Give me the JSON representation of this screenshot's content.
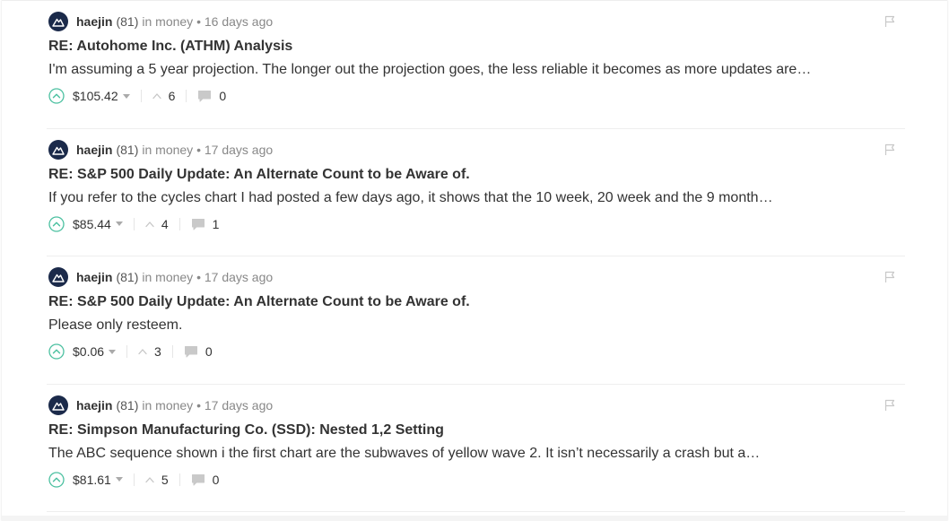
{
  "colors": {
    "avatar_bg": "#1b2a4a",
    "upvote_green": "#4bc0a0",
    "muted": "#888888"
  },
  "icons": {
    "upvote": "chevron-up-circle-icon",
    "votes": "chevron-up-icon",
    "comments": "comment-icon",
    "flag": "flag-icon",
    "payout_menu": "caret-down-icon"
  },
  "posts": [
    {
      "author": "haejin",
      "reputation": "(81)",
      "meta": "in money • 16 days ago",
      "title": "RE: Autohome Inc. (ATHM) Analysis",
      "body": "I'm assuming a 5 year projection. The longer out the projection goes, the less reliable it becomes as more updates are…",
      "payout": "$105.42",
      "votes": "6",
      "comments": "0"
    },
    {
      "author": "haejin",
      "reputation": "(81)",
      "meta": "in money • 17 days ago",
      "title": "RE: S&P 500 Daily Update: An Alternate Count to be Aware of.",
      "body": "If you refer to the cycles chart I had posted a few days ago, it shows that the 10 week, 20 week and the 9 month…",
      "payout": "$85.44",
      "votes": "4",
      "comments": "1"
    },
    {
      "author": "haejin",
      "reputation": "(81)",
      "meta": "in money • 17 days ago",
      "title": "RE: S&P 500 Daily Update: An Alternate Count to be Aware of.",
      "body": "Please only resteem.",
      "payout": "$0.06",
      "votes": "3",
      "comments": "0"
    },
    {
      "author": "haejin",
      "reputation": "(81)",
      "meta": "in money • 17 days ago",
      "title": "RE: Simpson Manufacturing Co. (SSD): Nested 1,2 Setting",
      "body": "The ABC sequence shown i the first chart are the subwaves of yellow wave 2. It isn’t necessarily a crash but a…",
      "payout": "$81.61",
      "votes": "5",
      "comments": "0"
    }
  ]
}
